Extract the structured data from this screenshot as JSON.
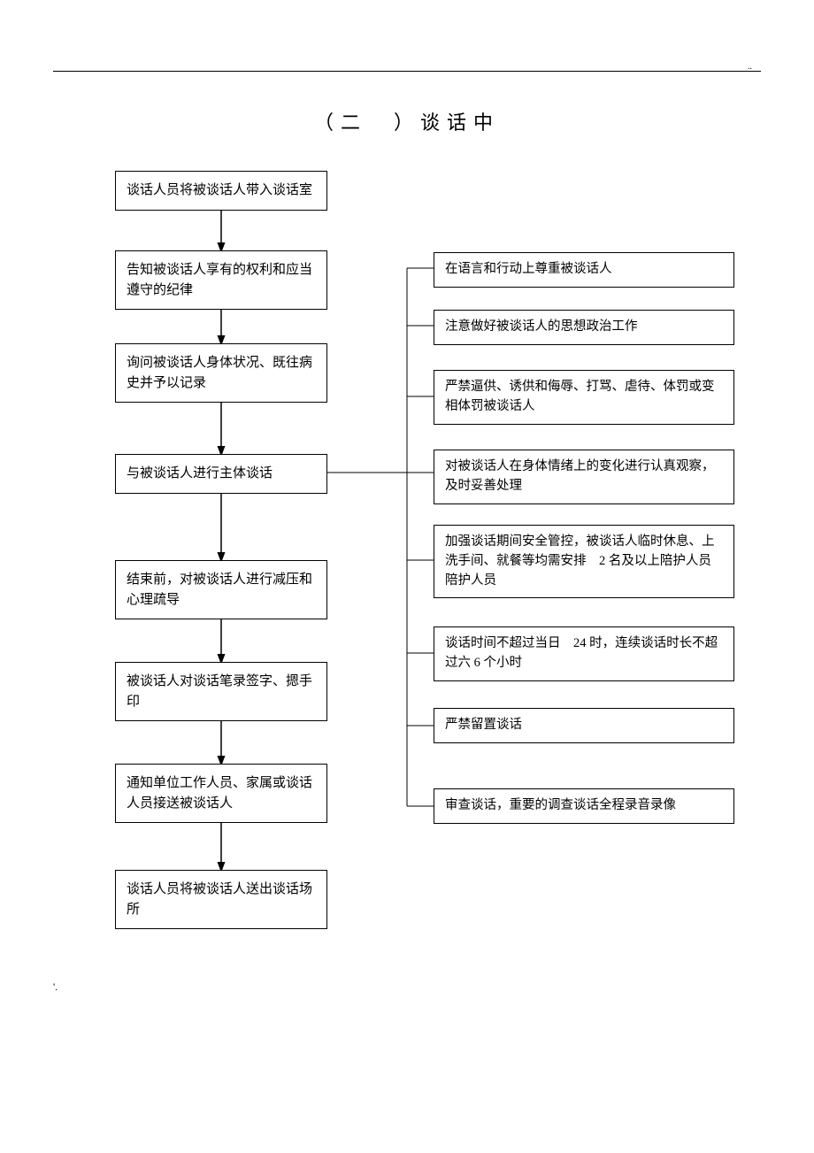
{
  "title": "（二　）谈话中",
  "left": {
    "b1": "谈话人员将被谈话人带入谈话室",
    "b2": "告知被谈话人享有的权利和应当遵守的纪律",
    "b3": "询问被谈话人身体状况、既往病史并予以记录",
    "b4": "与被谈话人进行主体谈话",
    "b5": "结束前，对被谈话人进行减压和心理疏导",
    "b6": "被谈话人对谈话笔录签字、摁手印",
    "b7": "通知单位工作人员、家属或谈话人员接送被谈话人",
    "b8": "谈话人员将被谈话人送出谈话场所"
  },
  "right": {
    "r1": "在语言和行动上尊重被谈话人",
    "r2": "注意做好被谈话人的思想政治工作",
    "r3": "严禁逼供、诱供和侮辱、打骂、虐待、体罚或变相体罚被谈话人",
    "r4": "对被谈话人在身体情绪上的变化进行认真观察，及时妥善处理",
    "r5": "加强谈话期间安全管控，被谈话人临时休息、上洗手间、就餐等均需安排　2 名及以上陪护人员陪护人员",
    "r6": "谈话时间不超过当日　24 时，连续谈话时长不超过六 6 个小时",
    "r7": "严禁留置谈话",
    "r8": "审查谈话，重要的调查谈话全程录音录像"
  },
  "page_num": "'."
}
